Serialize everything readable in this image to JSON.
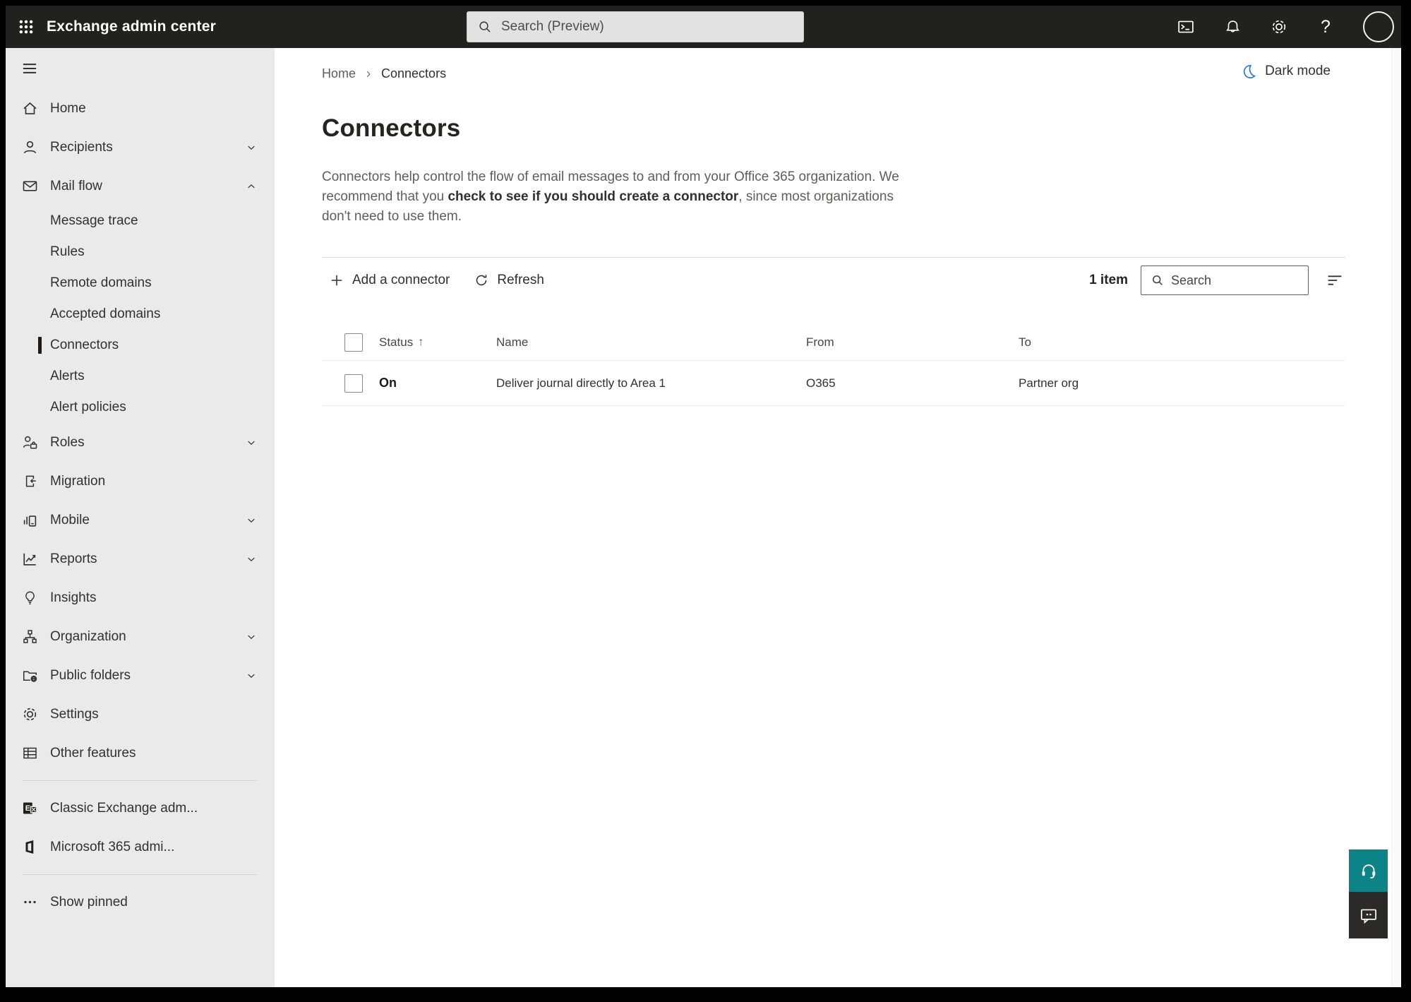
{
  "topbar": {
    "app_title": "Exchange admin center",
    "search_placeholder": "Search (Preview)",
    "help_glyph": "?"
  },
  "sidebar": {
    "items": [
      {
        "label": "Home"
      },
      {
        "label": "Recipients"
      },
      {
        "label": "Mail flow"
      },
      {
        "label": "Message trace"
      },
      {
        "label": "Rules"
      },
      {
        "label": "Remote domains"
      },
      {
        "label": "Accepted domains"
      },
      {
        "label": "Connectors"
      },
      {
        "label": "Alerts"
      },
      {
        "label": "Alert policies"
      },
      {
        "label": "Roles"
      },
      {
        "label": "Migration"
      },
      {
        "label": "Mobile"
      },
      {
        "label": "Reports"
      },
      {
        "label": "Insights"
      },
      {
        "label": "Organization"
      },
      {
        "label": "Public folders"
      },
      {
        "label": "Settings"
      },
      {
        "label": "Other features"
      },
      {
        "label": "Classic Exchange adm..."
      },
      {
        "label": "Microsoft 365 admi..."
      },
      {
        "label": "Show pinned"
      }
    ]
  },
  "breadcrumb": {
    "home": "Home",
    "separator": "›",
    "current": "Connectors"
  },
  "page": {
    "dark_mode_label": "Dark mode",
    "title": "Connectors",
    "description_part1": "Connectors help control the flow of email messages to and from your Office 365 organization. We recommend that you ",
    "description_link": "check to see if you should create a connector",
    "description_part2": ", since most organizations don't need to use them."
  },
  "toolbar": {
    "add_connector_label": "Add a connector",
    "refresh_label": "Refresh",
    "item_count": "1 item",
    "search_placeholder": "Search"
  },
  "table": {
    "headers": {
      "status": "Status",
      "name": "Name",
      "from": "From",
      "to": "To"
    },
    "sort_indicator": "↑",
    "rows": [
      {
        "status": "On",
        "name": "Deliver journal directly to Area 1",
        "from": "O365",
        "to": "Partner org"
      }
    ]
  },
  "colors": {
    "topbar_bg": "#212120",
    "sidebar_bg": "#eaeaea",
    "accent_teal": "#0b8387",
    "dark_mode_icon_blue": "#2b7cd3"
  }
}
